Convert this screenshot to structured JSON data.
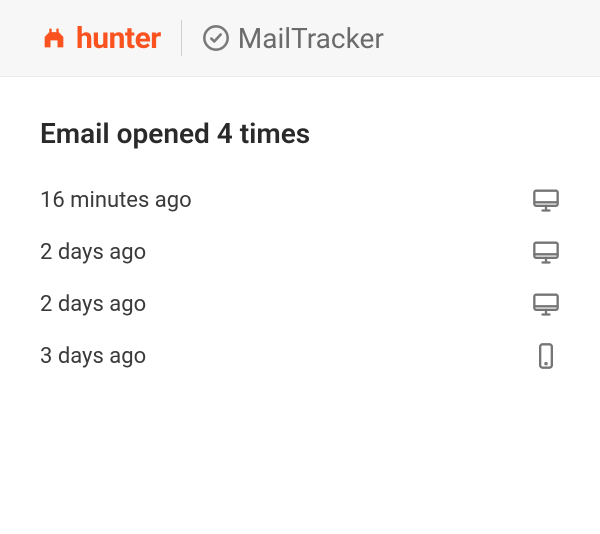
{
  "header": {
    "brand_name": "hunter",
    "product_name": "MailTracker",
    "brand_color": "#FA5320"
  },
  "main": {
    "heading": "Email opened 4 times",
    "opens": [
      {
        "time": "16 minutes ago",
        "device": "desktop"
      },
      {
        "time": "2 days ago",
        "device": "desktop"
      },
      {
        "time": "2 days ago",
        "device": "desktop"
      },
      {
        "time": "3 days ago",
        "device": "mobile"
      }
    ]
  }
}
